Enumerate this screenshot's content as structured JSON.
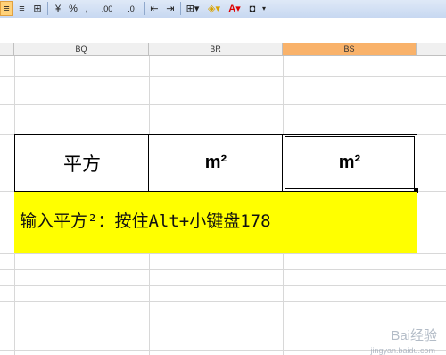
{
  "toolbar": {
    "percent": "%",
    "comma": ",",
    "dec_inc": ".00",
    "dec_dec": ".0"
  },
  "columns": [
    "BQ",
    "BR",
    "BS"
  ],
  "active_column": "BS",
  "table": {
    "bq_value": "平方",
    "br_value": "m²",
    "bs_value": "m²"
  },
  "note": "输入平方²：按住Alt+小键盘178",
  "watermark": {
    "brand": "Bai经验",
    "url": "jingyan.baidu.com"
  },
  "colors": {
    "highlight": "#ffff00",
    "active_header": "#f9b26a"
  }
}
